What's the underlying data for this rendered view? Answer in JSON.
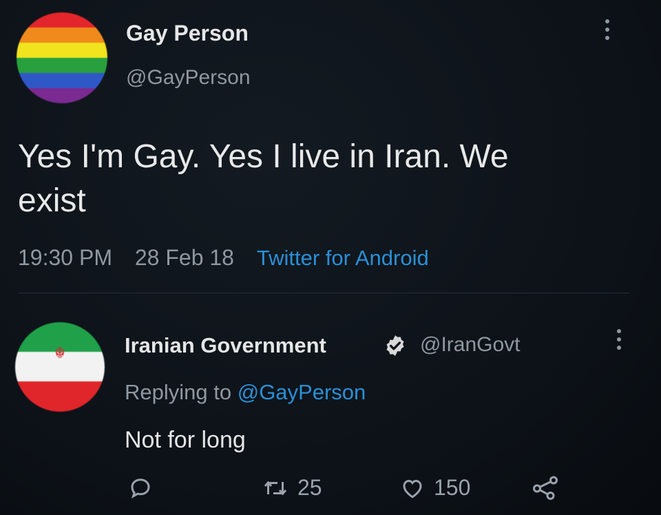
{
  "main_tweet": {
    "display_name": "Gay Person",
    "handle": "@GayPerson",
    "text_line1": "Yes I'm Gay. Yes I live in Iran. We",
    "text_line2": "exist",
    "time": "19:30 PM",
    "date": "28 Feb 18",
    "source": "Twitter for Android",
    "avatar_icon": "rainbow-flag-avatar"
  },
  "reply": {
    "display_name": "Iranian Government",
    "handle": "@IranGovt",
    "replying_prefix": "Replying to",
    "replying_mention": "@GayPerson",
    "text": "Not for long",
    "avatar_icon": "iran-flag-avatar",
    "verified_icon": "verified-badge-icon"
  },
  "actions": {
    "reply_icon": "reply-icon",
    "retweet_icon": "retweet-icon",
    "retweet_count": "25",
    "like_icon": "heart-icon",
    "like_count": "150",
    "share_icon": "share-icon"
  },
  "colors": {
    "background": "#0e1319",
    "link": "#2a8fd6",
    "secondary_text": "#8e98a2",
    "primary_text": "#e6e6e6"
  }
}
